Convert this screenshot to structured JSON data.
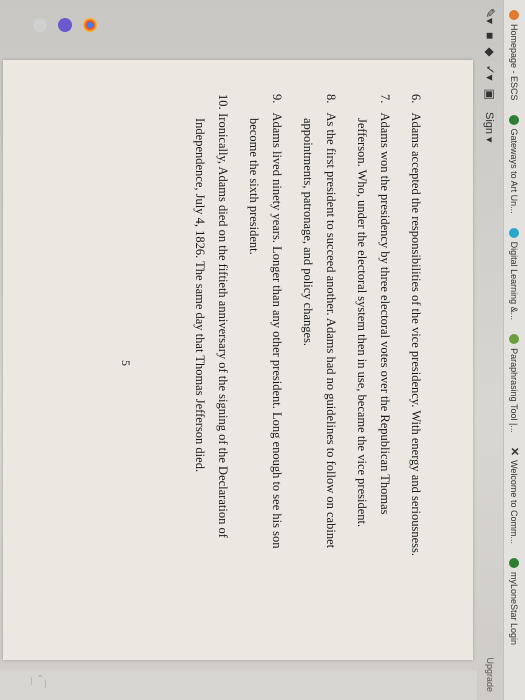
{
  "bookmarks": [
    {
      "label": "Homepage - ESCS",
      "color": "#e07a2e"
    },
    {
      "label": "Gateways to Art Un...",
      "color": "#2f7d32"
    },
    {
      "label": "Digital Learning &...",
      "color": "#2aa7c8"
    },
    {
      "label": "Paraphrasing Tool |...",
      "color": "#6c9e3c"
    },
    {
      "label": "Welcome to Comm...",
      "color": "#222222"
    },
    {
      "label": "myLoneStar Login",
      "color": "#2f7d32"
    }
  ],
  "toolbar": {
    "sign_label": "Sign ▾",
    "upgrade_label": "Upgrade"
  },
  "document": {
    "paragraphs": [
      {
        "num": "6.",
        "first": "Adams accepted the responsibilities of the vice presidency. With energy and seriousness.",
        "rest": ""
      },
      {
        "num": "7.",
        "first": "Adams won the presidency by three electoral votes over the Republican Thomas",
        "rest": "Jefferson. Who, under the electoral system then in use, became the vice president."
      },
      {
        "num": "8.",
        "first": "As the first president to succeed another. Adams had no guidelines to follow on cabinet",
        "rest": "appointments, patronage, and policy changes."
      },
      {
        "num": "9.",
        "first": "Adams lived ninety years. Longer than any other president. Long enough to see his son",
        "rest": "become the sixth president."
      },
      {
        "num": "10.",
        "first": "Ironically, Adams died on the fiftieth anniversary of the signing of the Declaration of",
        "rest": "Independence, July 4, 1826. The same day that Thomas Jefferson died."
      }
    ],
    "page_number": "5"
  },
  "right_tools": "‹ ⁀ ⁀"
}
